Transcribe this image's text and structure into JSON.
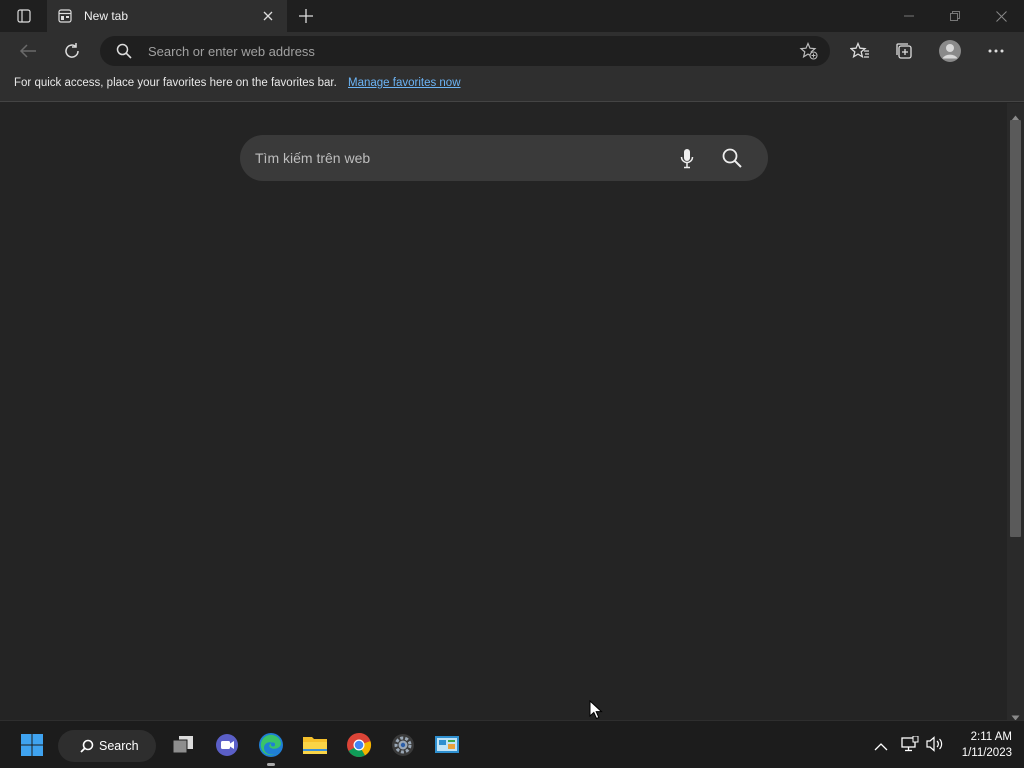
{
  "window": {
    "tab_title": "New tab"
  },
  "toolbar": {
    "address_placeholder": "Search or enter web address"
  },
  "favorites_bar": {
    "message": "For quick access, place your favorites here on the favorites bar.",
    "link_label": "Manage favorites now"
  },
  "page": {
    "search_placeholder": "Tìm kiếm trên web"
  },
  "taskbar": {
    "search_label": "Search",
    "apps": [
      "start-icon",
      "task-view-icon",
      "chat-icon",
      "edge-icon",
      "file-explorer-icon",
      "chrome-icon",
      "settings-icon",
      "control-panel-icon"
    ],
    "time": "2:11 AM",
    "date": "1/11/2023"
  },
  "colors": {
    "accent_link": "#6cb4f5",
    "background": "#242424"
  }
}
